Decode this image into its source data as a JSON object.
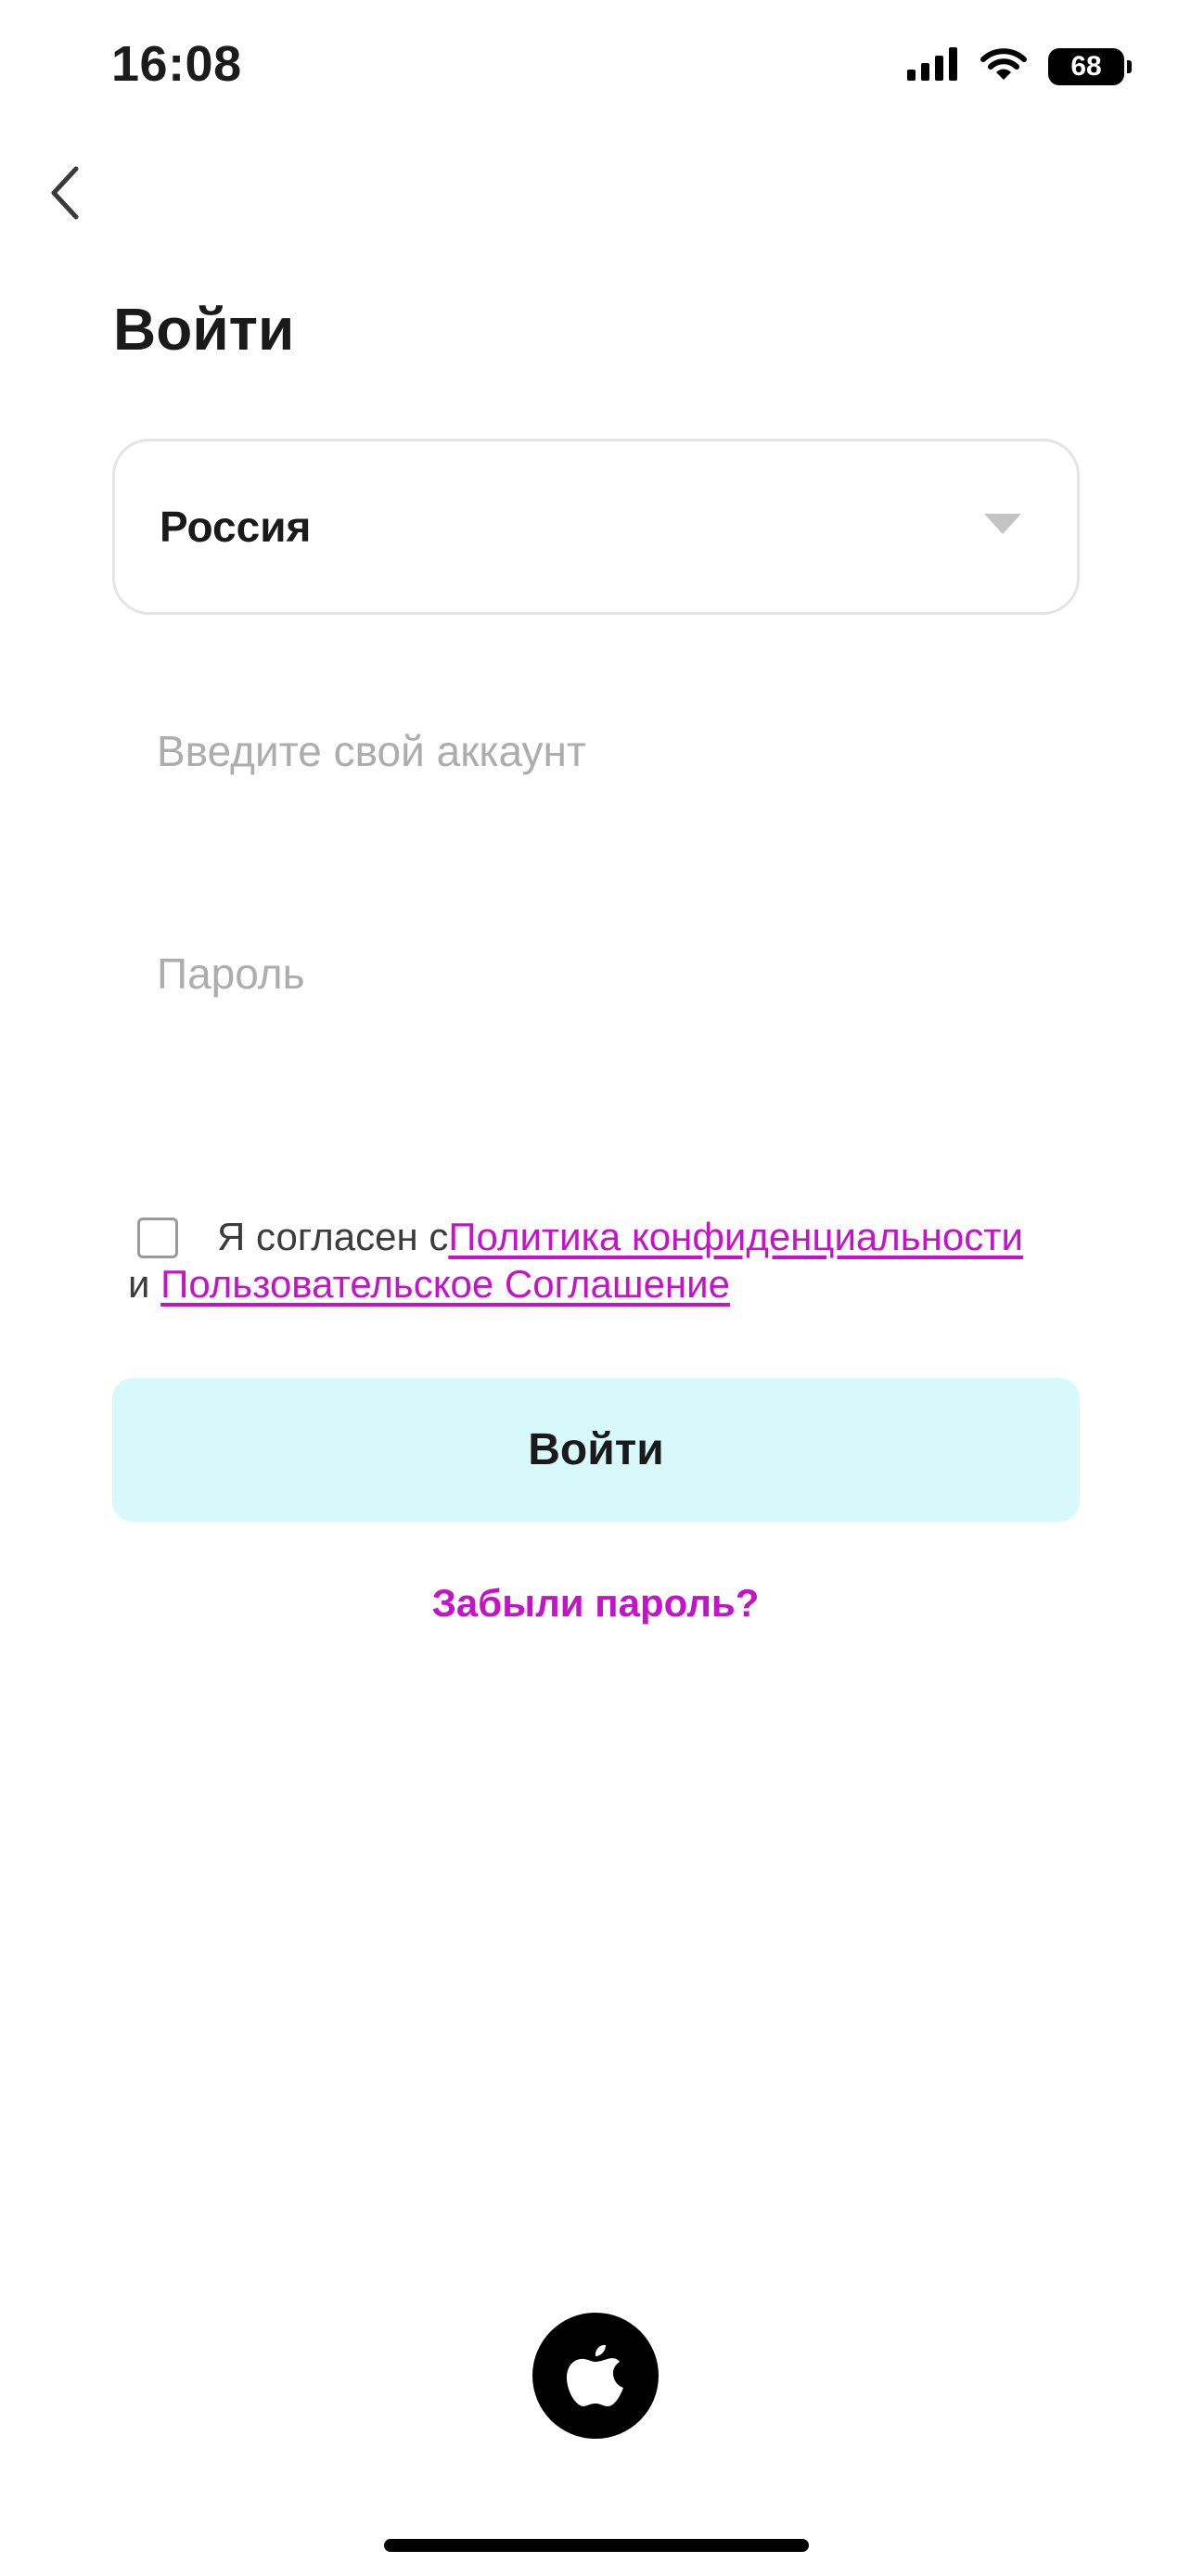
{
  "status_bar": {
    "time": "16:08",
    "battery": "68",
    "icons": [
      "cellular-signal-icon",
      "wifi-icon",
      "battery-icon"
    ]
  },
  "nav": {
    "back_icon": "chevron-left-icon"
  },
  "page": {
    "title": "Войти"
  },
  "country_select": {
    "value": "Россия",
    "icon": "caret-down-icon"
  },
  "account_field": {
    "placeholder": "Введите свой аккаунт",
    "value": ""
  },
  "password_field": {
    "placeholder": "Пароль",
    "value": ""
  },
  "agreement": {
    "checked": false,
    "prefix": "Я согласен с",
    "privacy_link": "Политика конфиденциальности",
    "conjunction": "и",
    "terms_link": "Пользовательское Соглашение"
  },
  "login_button": {
    "label": "Войти"
  },
  "forgot_password": {
    "label": "Забыли пароль?"
  },
  "social": {
    "apple_icon": "apple-logo-icon"
  },
  "colors": {
    "accent": "#c414c8",
    "button_bg": "#d8f9fc",
    "placeholder": "#adadad",
    "border": "#e4e4e4"
  }
}
